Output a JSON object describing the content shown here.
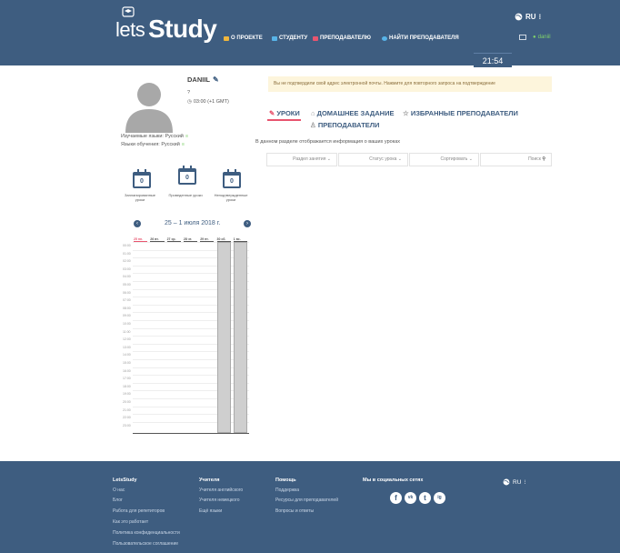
{
  "header": {
    "logo_lets": "lets",
    "logo_study": "Study",
    "nav": [
      {
        "label": "О ПРОЕКТЕ",
        "icon": "info-icon",
        "icon_color": "#f0b63c"
      },
      {
        "label": "СТУДЕНТУ",
        "icon": "student-icon",
        "icon_color": "#58b4e8"
      },
      {
        "label": "ПРЕПОДАВАТЕЛЮ",
        "icon": "teacher-icon",
        "icon_color": "#e8556f"
      },
      {
        "label": "НАЙТИ ПРЕПОДАВАТЕЛЯ",
        "icon": "search-icon",
        "icon_color": "#58b4e8"
      }
    ],
    "lang": "RU",
    "user": "daniil",
    "clock": "21:54"
  },
  "profile": {
    "name": "DANIIL",
    "line1": "?",
    "timezone": "03:00 (+1 GMT)",
    "learning": "Изучаемые языки: Русский",
    "native": "Языки обучения: Русский"
  },
  "stats": [
    {
      "count": "0",
      "label": "Запланированные уроки"
    },
    {
      "count": "0",
      "label": "Проведенные уроки"
    },
    {
      "count": "0",
      "label": "Неподтвержденные уроки"
    }
  ],
  "calendar": {
    "range": "25 – 1 июля 2018 г.",
    "days": [
      "25 пн.",
      "26 вт.",
      "27 ср.",
      "28 чт.",
      "29 пт.",
      "30 сб.",
      "1 вс."
    ],
    "times": [
      "00:00",
      "01:00",
      "02:00",
      "03:00",
      "04:00",
      "05:00",
      "06:00",
      "07:00",
      "08:00",
      "09:00",
      "10:00",
      "11:00",
      "12:00",
      "13:00",
      "14:00",
      "15:00",
      "16:00",
      "17:00",
      "18:00",
      "19:00",
      "20:00",
      "21:00",
      "22:00",
      "23:00"
    ]
  },
  "main": {
    "notice": "Вы не подтвердили свой адрес электронной почты. Нажмите для повторного запроса на подтверждение",
    "tabs": [
      "УРОКИ",
      "ДОМАШНЕЕ ЗАДАНИЕ",
      "ИЗБРАННЫЕ ПРЕПОДАВАТЕЛИ",
      "ПРЕПОДАВАТЕЛИ"
    ],
    "description": "В данном разделе отображается информация о ваших уроках",
    "filters": [
      "Раздел занятия",
      "Статус урока",
      "Сортировать",
      "Поиск"
    ]
  },
  "footer": {
    "col1_title": "LetsStudy",
    "col1": [
      "О нас",
      "Блог",
      "Работа для репетиторов",
      "Как это работает",
      "Политика конфиденциальности",
      "Пользовательское соглашение"
    ],
    "col2_title": "Учителя",
    "col2": [
      "Учителя английского",
      "Учителя немецкого",
      "Ещё языки"
    ],
    "col3_title": "Помощь",
    "col3": [
      "Поддержка",
      "Ресурсы для преподавателей",
      "Вопросы и ответы"
    ],
    "col4_title": "Мы в социальных сетях",
    "social": [
      "f",
      "vk",
      "t",
      "ig"
    ],
    "lang": "RU"
  },
  "colors": {
    "header": "#3e5d80",
    "accent": "#e8556f",
    "green": "#7fd16a",
    "blocked": "#cfcfcf"
  }
}
